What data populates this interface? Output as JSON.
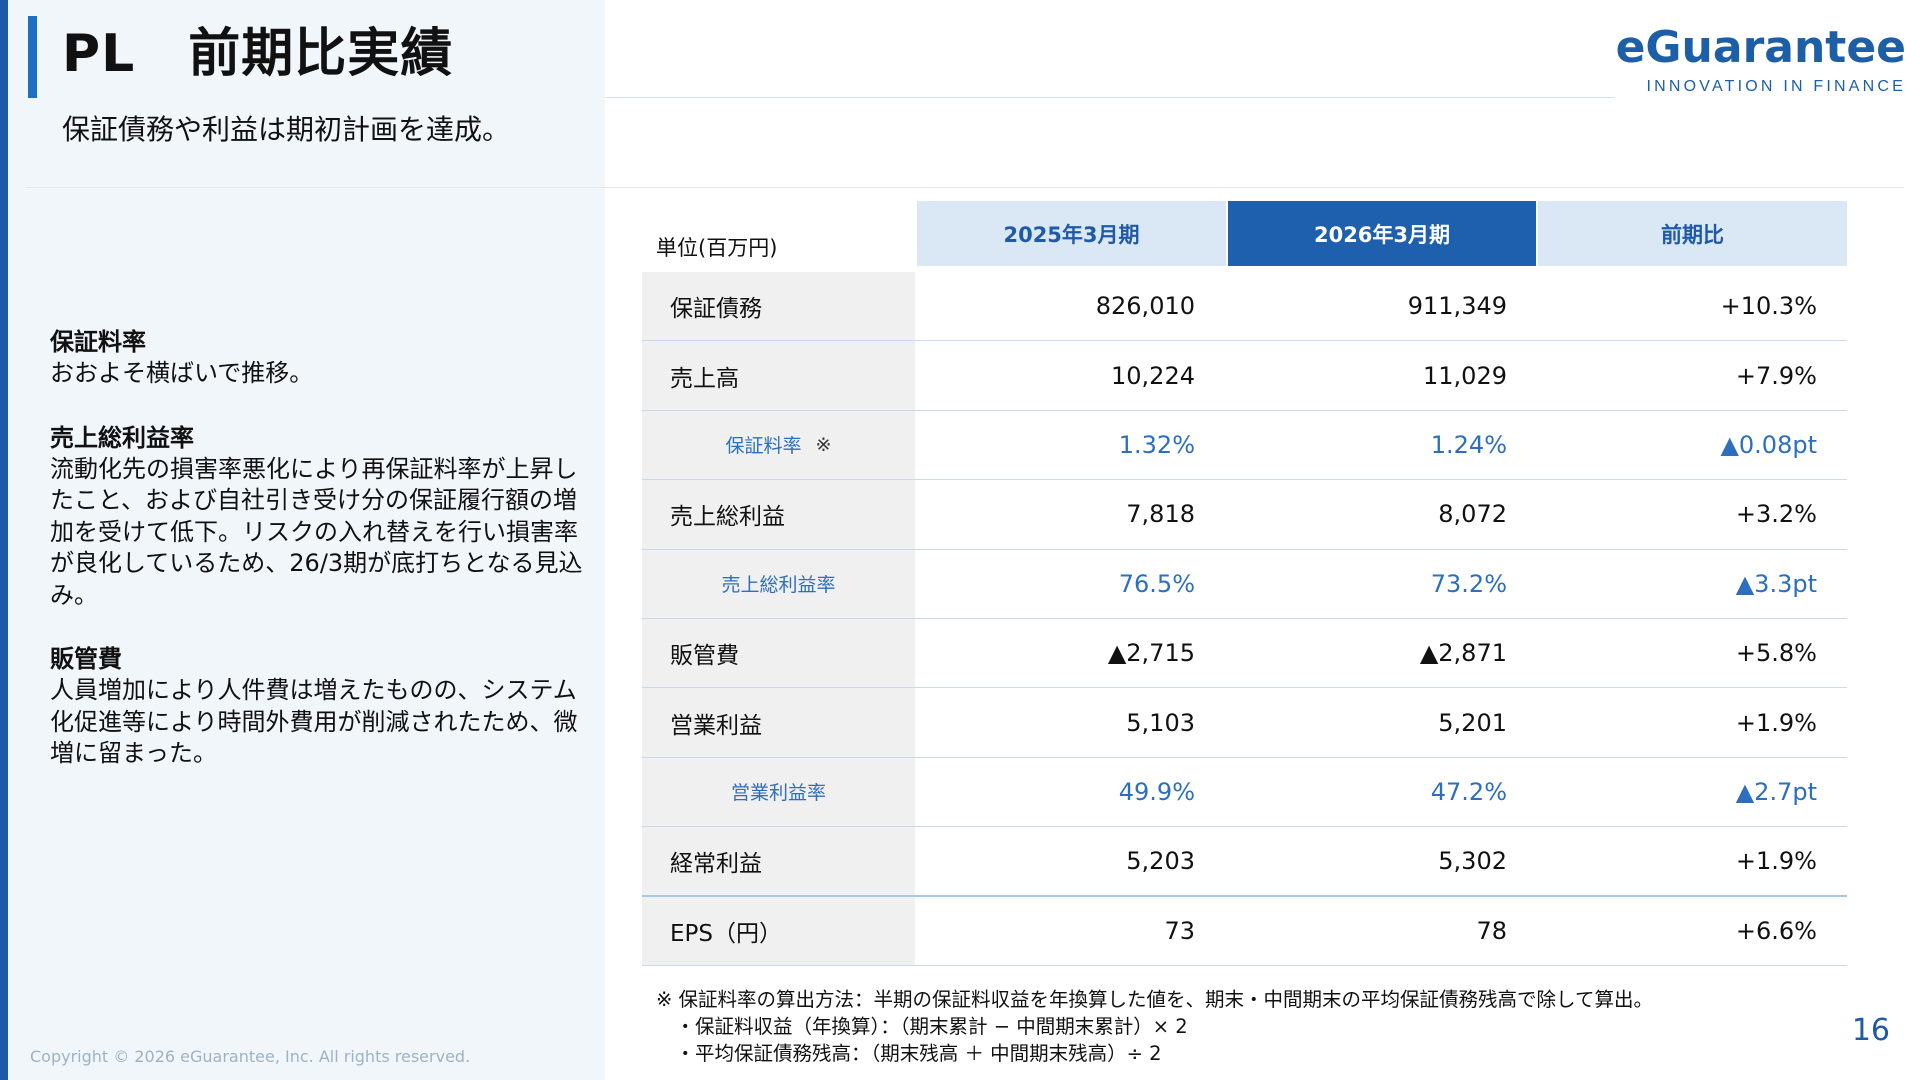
{
  "header": {
    "title": "PL　前期比実績",
    "subtitle": "保証債務や利益は期初計画を達成。"
  },
  "logo": {
    "name": "eGuarantee",
    "tagline": "INNOVATION IN FINANCE"
  },
  "notes": [
    {
      "heading": "保証料率",
      "body": "おおよそ横ばいで推移。"
    },
    {
      "heading": "売上総利益率",
      "body": "流動化先の損害率悪化により再保証料率が上昇したこと、および自社引き受け分の保証履行額の増加を受けて低下。リスクの入れ替えを行い損害率が良化しているため、26/3期が底打ちとなる見込み。"
    },
    {
      "heading": "販管費",
      "body": "人員増加により人件費は増えたものの、システム化促進等により時間外費用が削減されたため、微増に留まった。"
    }
  ],
  "table": {
    "unit": "単位(百万円)",
    "columns": [
      "2025年3月期",
      "2026年3月期",
      "前期比"
    ],
    "rows": [
      {
        "label": "保証債務",
        "v1": "826,010",
        "v2": "911,349",
        "v3": "+10.3%"
      },
      {
        "label": "売上高",
        "v1": "10,224",
        "v2": "11,029",
        "v3": "+7.9%"
      },
      {
        "label": "保証料率",
        "mark": "※",
        "v1": "1.32%",
        "v2": "1.24%",
        "v3": "▲0.08pt"
      },
      {
        "label": "売上総利益",
        "v1": "7,818",
        "v2": "8,072",
        "v3": "+3.2%"
      },
      {
        "label": "売上総利益率",
        "v1": "76.5%",
        "v2": "73.2%",
        "v3": "▲3.3pt"
      },
      {
        "label": "販管費",
        "v1": "▲2,715",
        "v2": "▲2,871",
        "v3": "+5.8%"
      },
      {
        "label": "営業利益",
        "v1": "5,103",
        "v2": "5,201",
        "v3": "+1.9%"
      },
      {
        "label": "営業利益率",
        "v1": "49.9%",
        "v2": "47.2%",
        "v3": "▲2.7pt"
      },
      {
        "label": "経常利益",
        "v1": "5,203",
        "v2": "5,302",
        "v3": "+1.9%"
      },
      {
        "label": "EPS（円）",
        "v1": "73",
        "v2": "78",
        "v3": "+6.6%"
      }
    ]
  },
  "footnote": {
    "line1": "※ 保証料率の算出方法：半期の保証料収益を年換算した値を、期末・中間期末の平均保証債務残高で除して算出。",
    "line2": "　・保証料収益（年換算）：（期末累計 − 中間期末累計）× 2",
    "line3": "　・平均保証債務残高：（期末残高 ＋ 中間期末残高）÷ 2"
  },
  "footer": {
    "copyright": "Copyright © 2026 eGuarantee, Inc. All rights reserved.",
    "page_number": "16"
  },
  "colors": {
    "brand_blue": "#1e5aa8",
    "header_light": "#dae8f6",
    "ratio_text": "#2c6fbe"
  }
}
